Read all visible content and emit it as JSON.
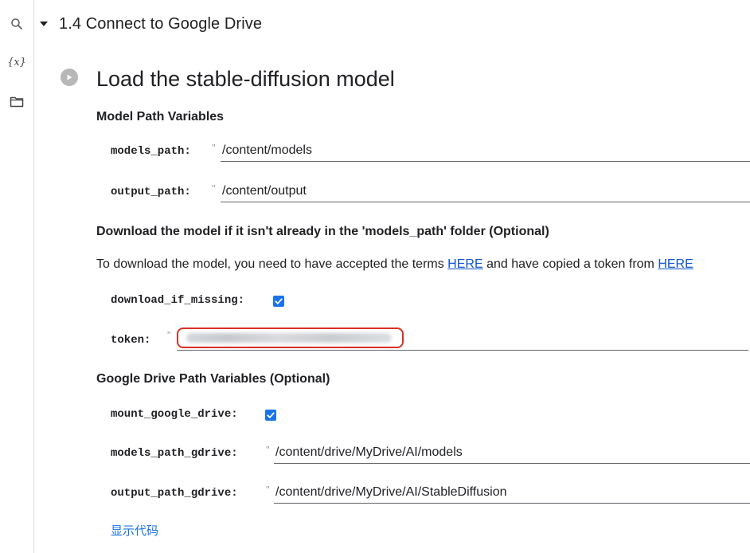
{
  "rail": {
    "items": [
      {
        "icon": "search-icon"
      },
      {
        "icon": "variables-icon",
        "label": "{x}"
      },
      {
        "icon": "folder-icon"
      }
    ]
  },
  "section": {
    "title": "1.4 Connect to Google Drive"
  },
  "cell": {
    "title": "Load the stable-diffusion model",
    "model_path_heading": "Model Path Variables",
    "models_path": {
      "label": "models_path:",
      "value": "/content/models"
    },
    "output_path": {
      "label": "output_path:",
      "value": "/content/output"
    },
    "download_heading": "Download the model if it isn't already in the 'models_path' folder (Optional)",
    "paragraph": {
      "before": "To download the model, you need to have accepted the terms ",
      "link1": "HERE",
      "middle": " and have copied a token from ",
      "link2": "HERE"
    },
    "download_if_missing": {
      "label": "download_if_missing:",
      "checked": true
    },
    "token": {
      "label": "token:"
    },
    "gdrive_heading": "Google Drive Path Variables (Optional)",
    "mount_google_drive": {
      "label": "mount_google_drive:",
      "checked": true
    },
    "models_path_gdrive": {
      "label": "models_path_gdrive:",
      "value": "/content/drive/MyDrive/AI/models"
    },
    "output_path_gdrive": {
      "label": "output_path_gdrive:",
      "value": "/content/drive/MyDrive/AI/StableDiffusion"
    },
    "show_code": "显示代码"
  },
  "colors": {
    "accent": "#1a73e8",
    "highlight_border": "#d93025",
    "link": "#1155cc"
  },
  "quote_glyph": "\""
}
